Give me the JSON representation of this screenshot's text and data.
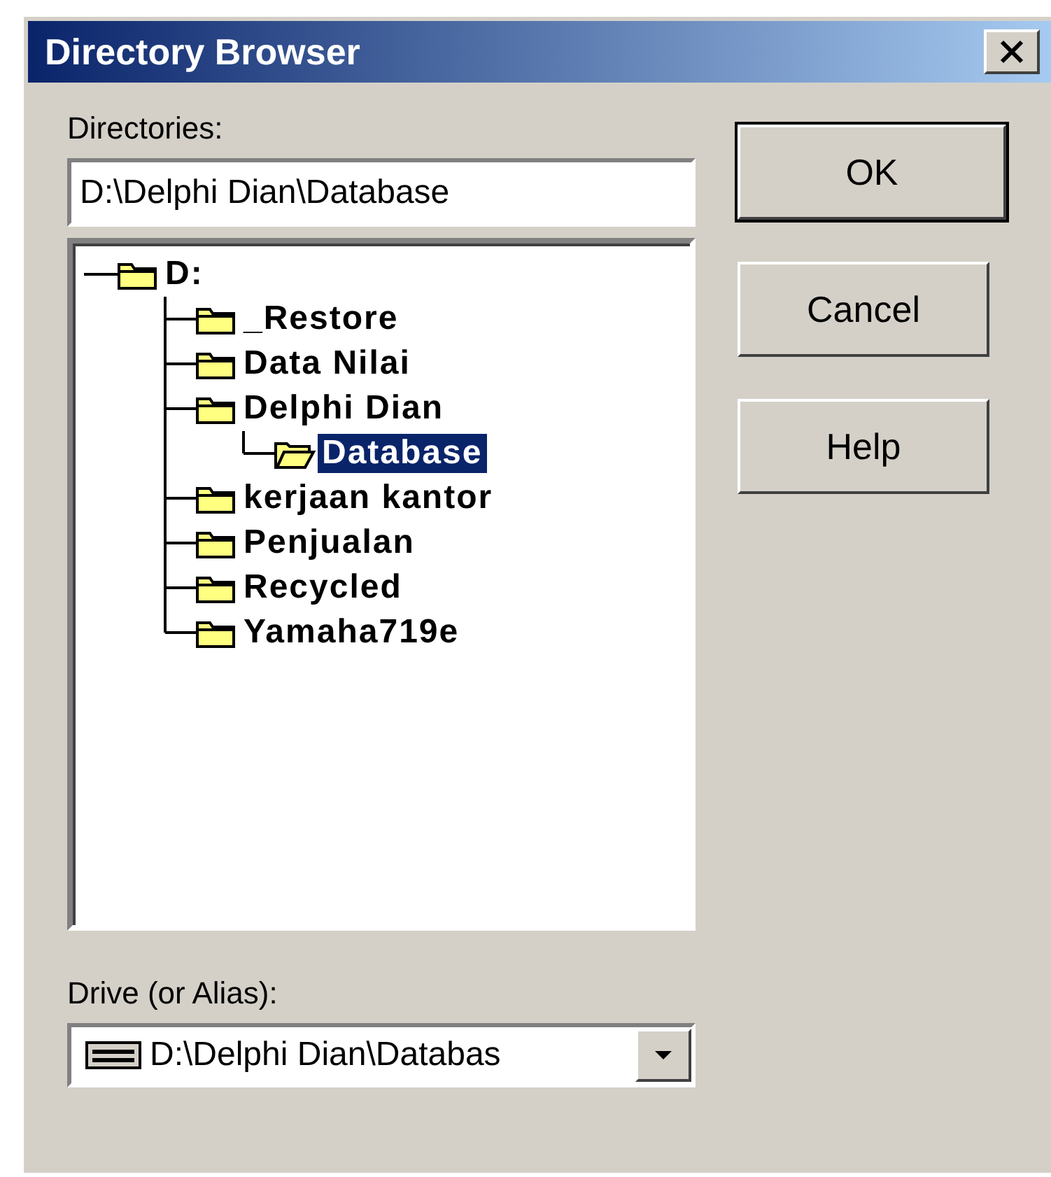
{
  "window": {
    "title": "Directory Browser"
  },
  "directories": {
    "label": "Directories:",
    "value": "D:\\Delphi Dian\\Database",
    "tree": [
      {
        "label": "D:",
        "selected": false,
        "children": [
          {
            "label": "_Restore",
            "selected": false
          },
          {
            "label": "Data Nilai",
            "selected": false
          },
          {
            "label": "Delphi Dian",
            "selected": false,
            "children": [
              {
                "label": "Database",
                "selected": true
              }
            ]
          },
          {
            "label": "kerjaan kantor",
            "selected": false
          },
          {
            "label": "Penjualan",
            "selected": false
          },
          {
            "label": "Recycled",
            "selected": false
          },
          {
            "label": "Yamaha719e",
            "selected": false
          }
        ]
      }
    ]
  },
  "drive": {
    "label": "Drive (or Alias):",
    "value": "D:\\Delphi Dian\\Databas"
  },
  "buttons": [
    {
      "label": "OK",
      "default": true
    },
    {
      "label": "Cancel",
      "default": false
    },
    {
      "label": "Help",
      "default": false
    }
  ]
}
